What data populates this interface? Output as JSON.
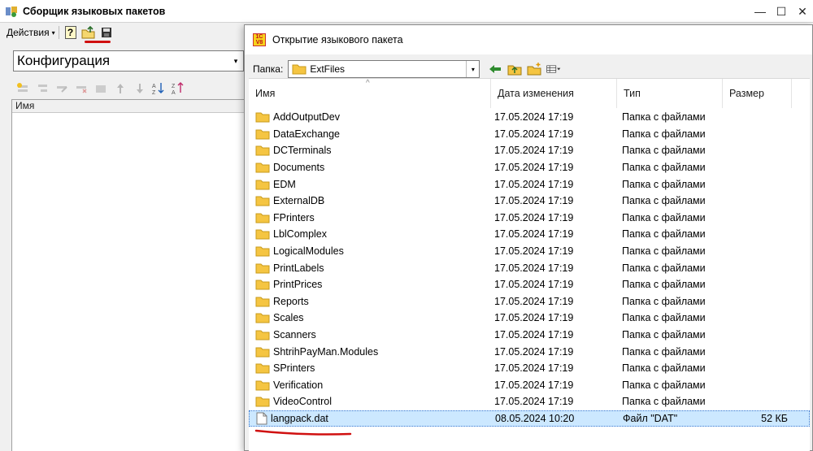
{
  "main_window": {
    "title": "Сборщик языковых пакетов",
    "controls": {
      "minimize": "—",
      "maximize": "☐",
      "close": "✕"
    },
    "toolbar": {
      "actions_label": "Действия",
      "caret": "▾",
      "help_label": "?"
    },
    "config_combo": {
      "value": "Конфигурация",
      "arrow": "▾"
    },
    "tree": {
      "column_header": "Имя"
    }
  },
  "dialog": {
    "logo_top": "1C",
    "logo_bottom": "V8",
    "title": "Открытие языкового пакета",
    "folder_label": "Папка:",
    "folder_value": "ExtFiles",
    "folder_arrow": "▾",
    "sort_caret": "^",
    "columns": {
      "name": "Имя",
      "date": "Дата изменения",
      "type": "Тип",
      "size": "Размер"
    },
    "rows": [
      {
        "name": "AddOutputDev",
        "date": "17.05.2024 17:19",
        "type": "Папка с файлами",
        "size": ""
      },
      {
        "name": "DataExchange",
        "date": "17.05.2024 17:19",
        "type": "Папка с файлами",
        "size": ""
      },
      {
        "name": "DCTerminals",
        "date": "17.05.2024 17:19",
        "type": "Папка с файлами",
        "size": ""
      },
      {
        "name": "Documents",
        "date": "17.05.2024 17:19",
        "type": "Папка с файлами",
        "size": ""
      },
      {
        "name": "EDM",
        "date": "17.05.2024 17:19",
        "type": "Папка с файлами",
        "size": ""
      },
      {
        "name": "ExternalDB",
        "date": "17.05.2024 17:19",
        "type": "Папка с файлами",
        "size": ""
      },
      {
        "name": "FPrinters",
        "date": "17.05.2024 17:19",
        "type": "Папка с файлами",
        "size": ""
      },
      {
        "name": "LblComplex",
        "date": "17.05.2024 17:19",
        "type": "Папка с файлами",
        "size": ""
      },
      {
        "name": "LogicalModules",
        "date": "17.05.2024 17:19",
        "type": "Папка с файлами",
        "size": ""
      },
      {
        "name": "PrintLabels",
        "date": "17.05.2024 17:19",
        "type": "Папка с файлами",
        "size": ""
      },
      {
        "name": "PrintPrices",
        "date": "17.05.2024 17:19",
        "type": "Папка с файлами",
        "size": ""
      },
      {
        "name": "Reports",
        "date": "17.05.2024 17:19",
        "type": "Папка с файлами",
        "size": ""
      },
      {
        "name": "Scales",
        "date": "17.05.2024 17:19",
        "type": "Папка с файлами",
        "size": ""
      },
      {
        "name": "Scanners",
        "date": "17.05.2024 17:19",
        "type": "Папка с файлами",
        "size": ""
      },
      {
        "name": "ShtrihPayMan.Modules",
        "date": "17.05.2024 17:19",
        "type": "Папка с файлами",
        "size": ""
      },
      {
        "name": "SPrinters",
        "date": "17.05.2024 17:19",
        "type": "Папка с файлами",
        "size": ""
      },
      {
        "name": "Verification",
        "date": "17.05.2024 17:19",
        "type": "Папка с файлами",
        "size": ""
      },
      {
        "name": "VideoControl",
        "date": "17.05.2024 17:19",
        "type": "Папка с файлами",
        "size": ""
      },
      {
        "name": "langpack.dat",
        "date": "08.05.2024 10:20",
        "type": "Файл \"DAT\"",
        "size": "52 КБ",
        "is_file": true,
        "selected": true
      }
    ]
  },
  "colors": {
    "selection": "#cce8ff",
    "annotation_red": "#d01010",
    "folder": "#f5c542"
  }
}
